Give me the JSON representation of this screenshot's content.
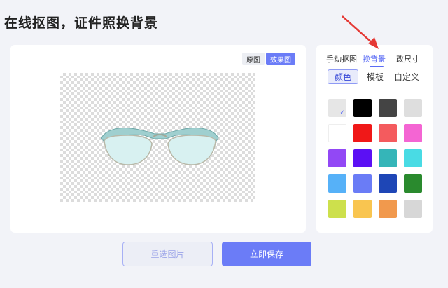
{
  "page_title": "在线抠图，证件照换背景",
  "preview": {
    "original_label": "原图",
    "effect_label": "效果图",
    "image_subject": "glasses"
  },
  "panel": {
    "tabs": [
      {
        "label": "手动抠图"
      },
      {
        "label": "换背景",
        "active": true
      },
      {
        "label": "改尺寸"
      }
    ],
    "subtabs": [
      {
        "label": "颜色",
        "active": true
      },
      {
        "label": "模板"
      },
      {
        "label": "自定义"
      }
    ],
    "swatches": [
      {
        "color": "#e6e6e6",
        "selected": true,
        "check_icon": "check-icon"
      },
      {
        "color": "#000000"
      },
      {
        "color": "#444444"
      },
      {
        "color": "#dedede"
      },
      {
        "color": "#ffffff"
      },
      {
        "color": "#f01818"
      },
      {
        "color": "#f45b5e"
      },
      {
        "color": "#f465d3"
      },
      {
        "color": "#9248f5"
      },
      {
        "color": "#5b10f4"
      },
      {
        "color": "#35b5b8"
      },
      {
        "color": "#49dbe4"
      },
      {
        "color": "#56b1f8"
      },
      {
        "color": "#6a7cf6"
      },
      {
        "color": "#1e46b6"
      },
      {
        "color": "#2a8a2e"
      },
      {
        "color": "#cde04c"
      },
      {
        "color": "#f9c550"
      },
      {
        "color": "#f1994d"
      },
      {
        "color": "#d7d7d7"
      }
    ]
  },
  "actions": {
    "reselect_label": "重选图片",
    "save_label": "立即保存"
  },
  "accent_color": "#6b7cf7",
  "annotation_color": "#e53935"
}
